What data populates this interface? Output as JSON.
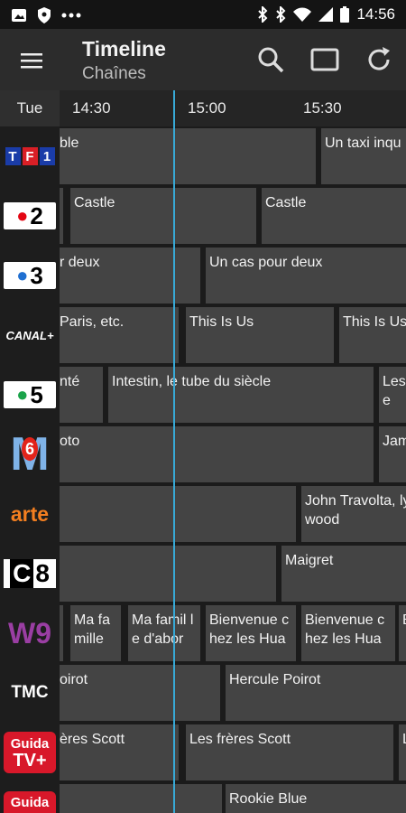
{
  "status_bar": {
    "time": "14:56",
    "left_icons": [
      "image-icon",
      "shield-icon",
      "more-dots-icon"
    ],
    "right_icons": [
      "bluetooth-icon",
      "bluetooth-alt-icon",
      "wifi-icon",
      "signal-icon",
      "battery-icon"
    ]
  },
  "app_bar": {
    "title": "Timeline",
    "subtitle": "Chaînes",
    "actions": [
      "search-icon",
      "fullscreen-icon",
      "refresh-icon"
    ]
  },
  "time_header": {
    "day": "Tue",
    "ticks": [
      "14:30",
      "15:00",
      "15:30"
    ]
  },
  "channels": [
    {
      "name": "TF1",
      "logo_text": "TF1"
    },
    {
      "name": "France 2",
      "logo_text": "2"
    },
    {
      "name": "France 3",
      "logo_text": "3"
    },
    {
      "name": "Canal+",
      "logo_text": "CANAL+"
    },
    {
      "name": "France 5",
      "logo_text": "5"
    },
    {
      "name": "M6",
      "logo_text": "6"
    },
    {
      "name": "Arte",
      "logo_text": "arte"
    },
    {
      "name": "C8",
      "logo_text": "C8"
    },
    {
      "name": "W9",
      "logo_text": "W9"
    },
    {
      "name": "TMC",
      "logo_text": "TMC"
    },
    {
      "name": "Guida TV+",
      "logo_text": "Guida TV+"
    },
    {
      "name": "Guida",
      "logo_text": "Guida"
    }
  ],
  "programs": [
    [
      {
        "title": "ble"
      },
      {
        "title": "Un taxi inqu"
      }
    ],
    [
      {
        "title": ""
      },
      {
        "title": "Castle"
      },
      {
        "title": "Castle"
      }
    ],
    [
      {
        "title": "r deux"
      },
      {
        "title": "Un cas pour deux"
      }
    ],
    [
      {
        "title": "Paris, etc."
      },
      {
        "title": "This Is Us"
      },
      {
        "title": "This Is Us"
      }
    ],
    [
      {
        "title": "nté"
      },
      {
        "title": "Intestin, le tube du siècle"
      },
      {
        "title": "Les e"
      }
    ],
    [
      {
        "title": "oto"
      },
      {
        "title": "Jam"
      }
    ],
    [
      {
        "title": ""
      },
      {
        "title": "John Travolta, lywood"
      }
    ],
    [
      {
        "title": ""
      },
      {
        "title": "Maigret"
      }
    ],
    [
      {
        "title": ""
      },
      {
        "title": "Ma fa mille"
      },
      {
        "title": "Ma famil le d'abor"
      },
      {
        "title": "Bienvenue c hez les Hua"
      },
      {
        "title": "Bienvenue c hez les Hua"
      },
      {
        "title": "B"
      }
    ],
    [
      {
        "title": "oirot"
      },
      {
        "title": "Hercule Poirot"
      }
    ],
    [
      {
        "title": "ères Scott"
      },
      {
        "title": "Les frères Scott"
      },
      {
        "title": "L"
      }
    ],
    [
      {
        "title": ""
      },
      {
        "title": "Rookie Blue"
      }
    ]
  ],
  "colors": {
    "accent_now_line": "#38a9d6",
    "cell_bg": "#444444",
    "background": "#1b1b1b",
    "app_bar": "#2c2c2c"
  }
}
